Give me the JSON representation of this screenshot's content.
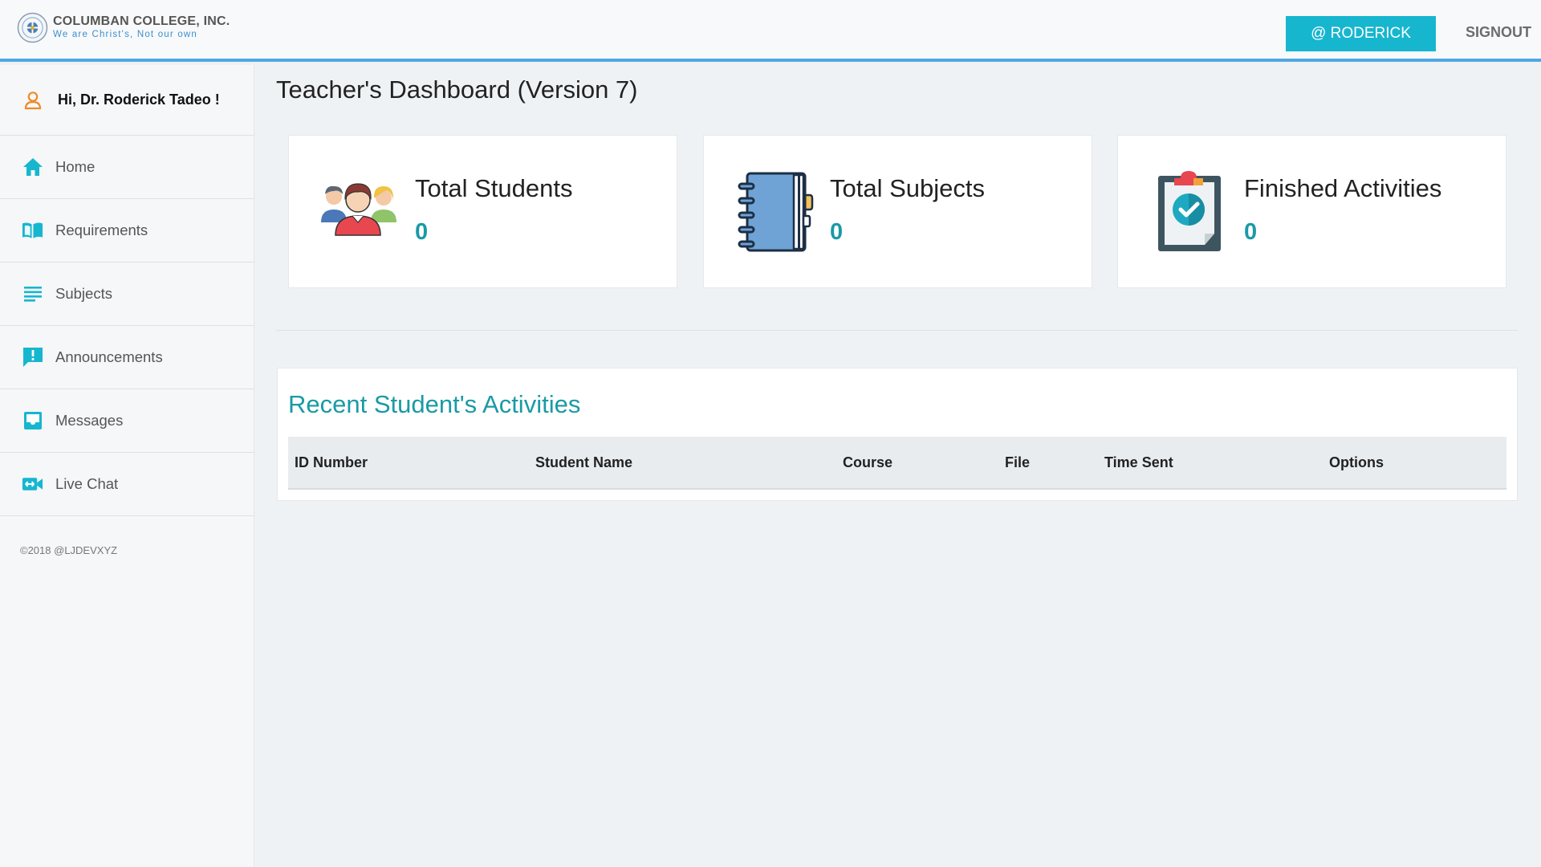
{
  "header": {
    "brand_name": "COLUMBAN COLLEGE, INC.",
    "brand_tagline": "We are Christ's, Not our own",
    "user_button": "@ RODERICK",
    "signout": "SIGNOUT"
  },
  "sidebar": {
    "greeting": "Hi, Dr. Roderick Tadeo !",
    "items": [
      {
        "label": "Home",
        "icon": "home-icon"
      },
      {
        "label": "Requirements",
        "icon": "book-icon"
      },
      {
        "label": "Subjects",
        "icon": "list-icon"
      },
      {
        "label": "Announcements",
        "icon": "announcement-icon"
      },
      {
        "label": "Messages",
        "icon": "inbox-icon"
      },
      {
        "label": "Live Chat",
        "icon": "video-call-icon"
      }
    ],
    "footer": "©2018 @LJDEVXYZ"
  },
  "main": {
    "title": "Teacher's Dashboard (Version 7)",
    "cards": [
      {
        "title": "Total Students",
        "value": "0",
        "icon": "students-icon"
      },
      {
        "title": "Total Subjects",
        "value": "0",
        "icon": "notebook-icon"
      },
      {
        "title": "Finished Activities",
        "value": "0",
        "icon": "clipboard-check-icon"
      }
    ],
    "recent": {
      "title": "Recent Student's Activities",
      "columns": [
        "ID Number",
        "Student Name",
        "Course",
        "File",
        "Time Sent",
        "Options"
      ]
    }
  },
  "colors": {
    "accent": "#17b6cf",
    "teal_text": "#1a9aa6",
    "header_border": "#4ea8e4",
    "greeting_icon": "#f08a24"
  }
}
